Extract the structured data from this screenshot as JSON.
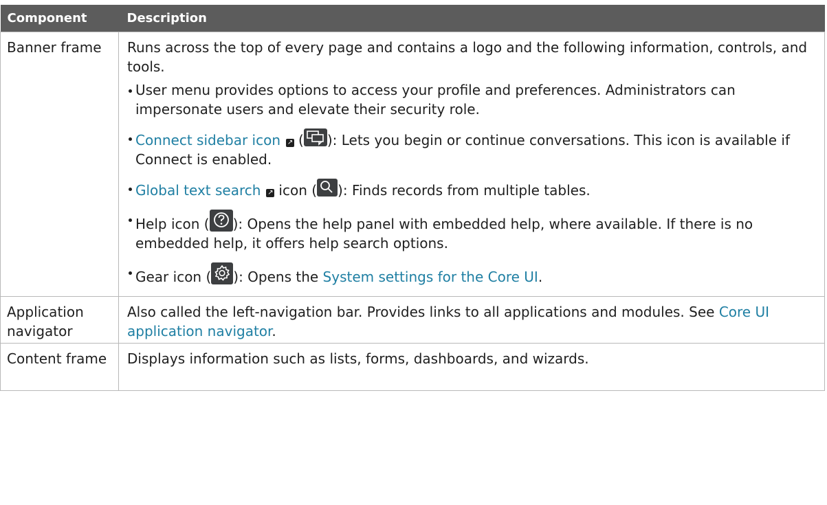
{
  "header": {
    "component": "Component",
    "description": "Description"
  },
  "rows": {
    "banner": {
      "name": "Banner frame",
      "intro": "Runs across the top of every page and contains a logo and the following information, controls, and tools.",
      "items": {
        "user_menu": {
          "text": "User menu provides options to access your profile and preferences. Administrators can impersonate users and elevate their security role."
        },
        "connect": {
          "link": "Connect sidebar icon",
          "open_paren": "(",
          "icon": "chat-bubbles-icon",
          "text": "): Lets you begin or continue conversations. This icon is available if Connect is enabled."
        },
        "search": {
          "link": "Global text search",
          "mid": "icon (",
          "icon": "search-icon",
          "text": "): Finds records from multiple tables."
        },
        "help": {
          "pre": "Help icon (",
          "icon": "help-icon",
          "text": "): Opens the help panel with embedded help, where available. If there is no embedded help, it offers help search options."
        },
        "gear": {
          "pre": "Gear icon (",
          "icon": "gear-icon",
          "mid": "): Opens the ",
          "link": "System settings for the Core UI",
          "post": "."
        }
      }
    },
    "app_nav": {
      "name": "Application navigator",
      "text": "Also called the left-navigation bar. Provides links to all applications and modules. See ",
      "link": "Core UI application navigator",
      "post": "."
    },
    "content": {
      "name": "Content frame",
      "text": "Displays information such as lists, forms, dashboards, and wizards."
    }
  },
  "colors": {
    "header_bg": "#5c5c5c",
    "link": "#1f7fa3",
    "icon_bg": "#3d3f41",
    "border": "#b8b8b8"
  }
}
